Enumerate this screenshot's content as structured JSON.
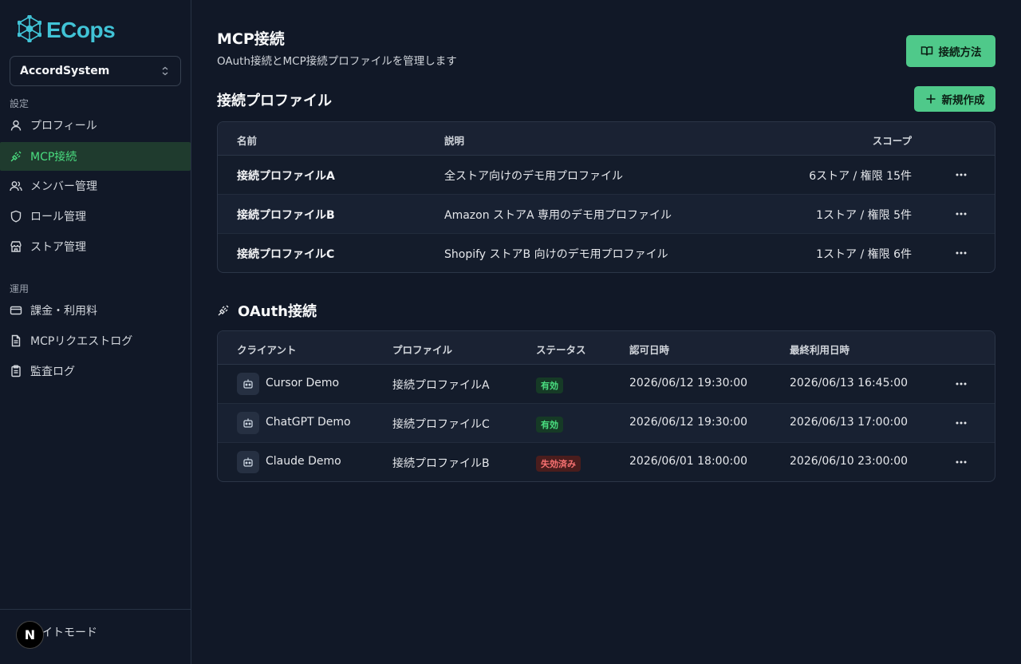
{
  "brand": {
    "name": "ECops",
    "color": "#41c3d6"
  },
  "org_select": {
    "value": "AccordSystem"
  },
  "sidebar": {
    "section_settings": "設定",
    "section_ops": "運用",
    "items": [
      {
        "label": "プロフィール",
        "icon": "user-icon"
      },
      {
        "label": "MCP接続",
        "icon": "plug-icon",
        "active": true
      },
      {
        "label": "メンバー管理",
        "icon": "users-icon"
      },
      {
        "label": "ロール管理",
        "icon": "shield-icon"
      },
      {
        "label": "ストア管理",
        "icon": "store-icon"
      },
      {
        "label": "課金・利用料",
        "icon": "credit-card-icon"
      },
      {
        "label": "MCPリクエストログ",
        "icon": "document-icon"
      },
      {
        "label": "監査ログ",
        "icon": "clipboard-icon"
      }
    ],
    "footer": {
      "theme_label": "ライトモード",
      "n_badge": "N"
    }
  },
  "page": {
    "title": "MCP接続",
    "subtitle": "OAuth接続とMCP接続プロファイルを管理します",
    "how_to_button": "接続方法"
  },
  "profiles": {
    "title": "接続プロファイル",
    "new_button": "新規作成",
    "columns": {
      "name": "名前",
      "description": "説明",
      "scope": "スコープ"
    },
    "rows": [
      {
        "name": "接続プロファイルA",
        "description": "全ストア向けのデモ用プロファイル",
        "scope": "6ストア / 権限 15件"
      },
      {
        "name": "接続プロファイルB",
        "description": "Amazon ストアA 専用のデモ用プロファイル",
        "scope": "1ストア / 権限 5件"
      },
      {
        "name": "接続プロファイルC",
        "description": "Shopify ストアB 向けのデモ用プロファイル",
        "scope": "1ストア / 権限 6件"
      }
    ]
  },
  "oauth": {
    "title": "OAuth接続",
    "columns": {
      "client": "クライアント",
      "profile": "プロファイル",
      "status": "ステータス",
      "authorized_at": "認可日時",
      "last_used_at": "最終利用日時"
    },
    "rows": [
      {
        "client": "Cursor Demo",
        "profile": "接続プロファイルA",
        "status": "有効",
        "status_kind": "ok",
        "authorized_at": "2026/06/12 19:30:00",
        "last_used_at": "2026/06/13 16:45:00"
      },
      {
        "client": "ChatGPT Demo",
        "profile": "接続プロファイルC",
        "status": "有効",
        "status_kind": "ok",
        "authorized_at": "2026/06/12 19:30:00",
        "last_used_at": "2026/06/13 17:00:00"
      },
      {
        "client": "Claude Demo",
        "profile": "接続プロファイルB",
        "status": "失効済み",
        "status_kind": "ng",
        "authorized_at": "2026/06/01 18:00:00",
        "last_used_at": "2026/06/10 23:00:00"
      }
    ]
  },
  "colors": {
    "accent_green": "#4fc98a",
    "active_nav": "#4ade80",
    "background": "#111827"
  }
}
